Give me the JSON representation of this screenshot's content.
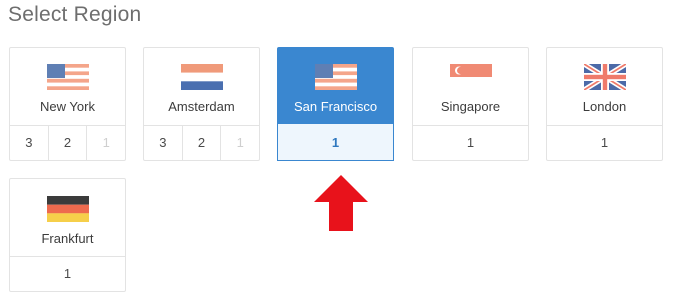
{
  "page": {
    "title": "Select Region"
  },
  "regions": [
    {
      "name": "New York",
      "flag": "us-flag-icon",
      "slots": [
        "3",
        "2",
        "1"
      ],
      "faded": [
        false,
        false,
        true
      ],
      "selected": false
    },
    {
      "name": "Amsterdam",
      "flag": "netherlands-flag-icon",
      "slots": [
        "3",
        "2",
        "1"
      ],
      "faded": [
        false,
        false,
        true
      ],
      "selected": false
    },
    {
      "name": "San Francisco",
      "flag": "us-flag-icon",
      "slots": [
        "1"
      ],
      "faded": [
        false
      ],
      "selected": true
    },
    {
      "name": "Singapore",
      "flag": "singapore-flag-icon",
      "slots": [
        "1"
      ],
      "faded": [
        false
      ],
      "selected": false
    },
    {
      "name": "London",
      "flag": "uk-flag-icon",
      "slots": [
        "1"
      ],
      "faded": [
        false
      ],
      "selected": false
    },
    {
      "name": "Frankfurt",
      "flag": "germany-flag-icon",
      "slots": [
        "1"
      ],
      "faded": [
        false
      ],
      "selected": false
    }
  ],
  "colors": {
    "selected_bg": "#3a87d0",
    "selected_slot_bg": "#eef6fd",
    "arrow": "#e8121b"
  }
}
